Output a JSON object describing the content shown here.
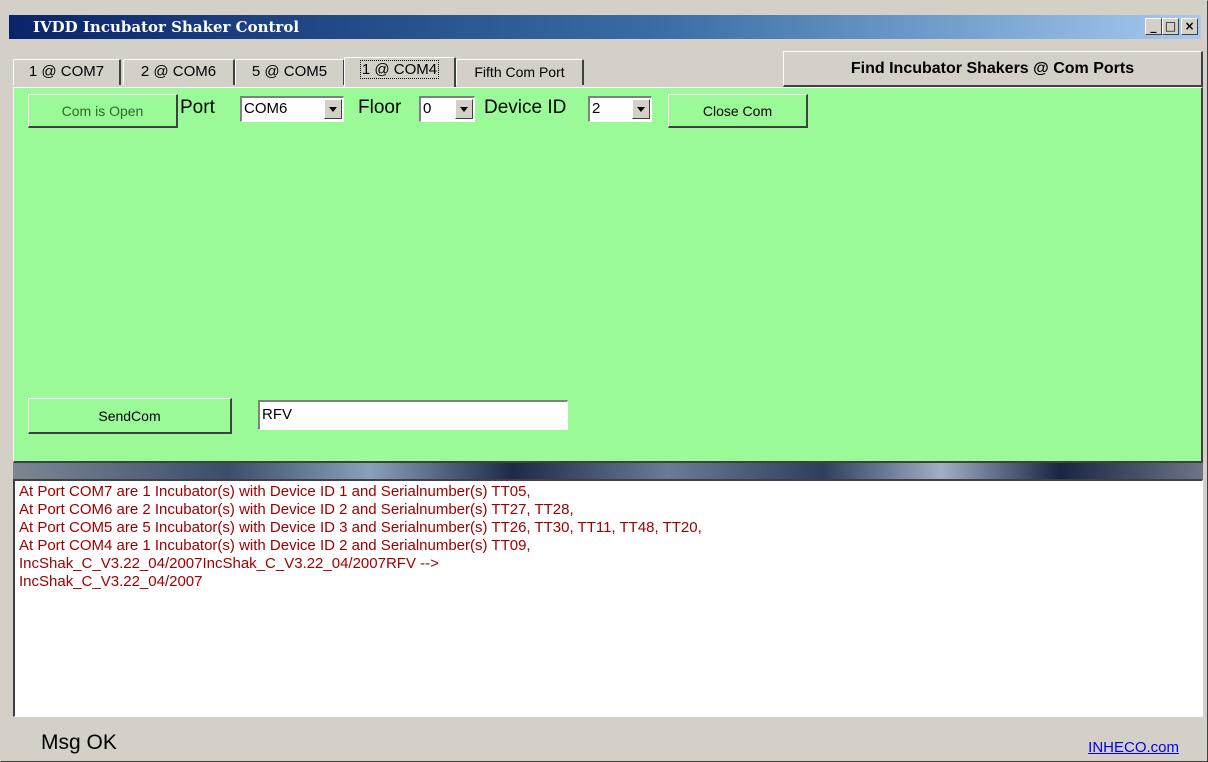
{
  "window": {
    "title": "IVDD Incubator Shaker Control",
    "controls": [
      "_",
      "□",
      "×"
    ]
  },
  "tabs": [
    {
      "label": "1 @ COM7"
    },
    {
      "label": "2 @ COM6"
    },
    {
      "label": "5 @ COM5"
    },
    {
      "label": "1 @ COM4",
      "active": true
    },
    {
      "label": "Fifth Com Port"
    }
  ],
  "find_button": {
    "label": "Find Incubator Shakers @ Com Ports"
  },
  "panel": {
    "com_status_button": "Com is Open",
    "port_label": "Port",
    "port_value": "COM6",
    "floor_label": "Floor",
    "floor_value": "0",
    "device_label": "Device ID",
    "device_value": "2",
    "close_button": "Close Com",
    "send_button": "SendCom",
    "command_value": "RFV",
    "background_color": "#9afa98"
  },
  "log": {
    "lines": [
      "At Port COM7 are 1 Incubator(s) with Device ID 1 and Serialnumber(s) TT05,",
      "At Port COM6 are 2 Incubator(s) with Device ID 2 and Serialnumber(s) TT27, TT28,",
      "At Port COM5 are 5 Incubator(s) with Device ID 3 and Serialnumber(s) TT26, TT30, TT11, TT48, TT20,",
      "At Port COM4 are 1 Incubator(s) with Device ID 2 and Serialnumber(s) TT09,",
      "IncShak_C_V3.22_04/2007IncShak_C_V3.22_04/2007RFV -->",
      "IncShak_C_V3.22_04/2007"
    ],
    "text_color": "#a00000"
  },
  "status": {
    "message": "Msg OK",
    "link": "INHECO.com"
  }
}
